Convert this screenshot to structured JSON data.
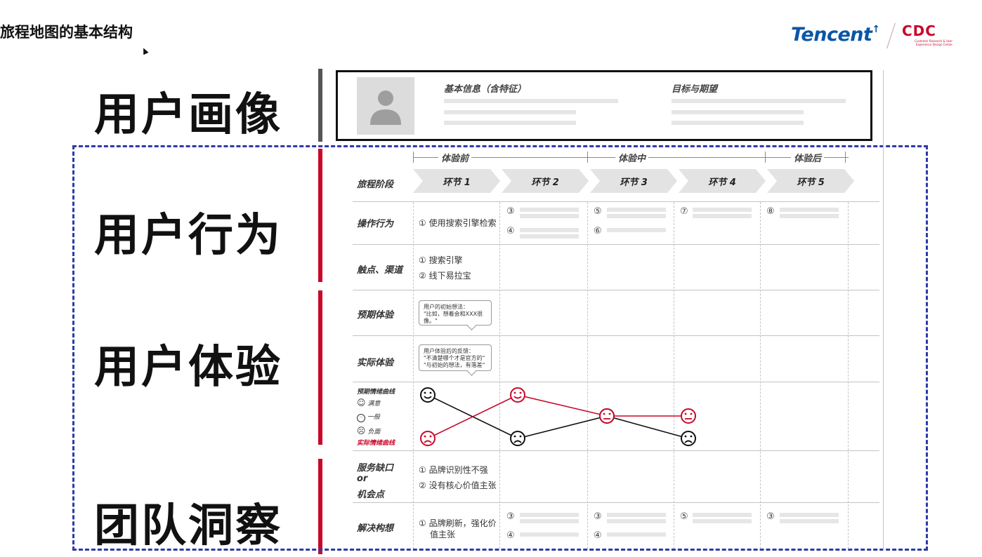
{
  "page_title": "旅程地图的基本结构",
  "logo": {
    "brand": "Tencent",
    "brand_mark": "↑",
    "cdc": "CDC",
    "cdc_sub": "Customer Research & User Experience Design Center"
  },
  "left_labels": [
    "用户画像",
    "用户行为",
    "用户体验",
    "团队洞察"
  ],
  "persona": {
    "basic_info": "基本信息（含特征）",
    "goals": "目标与期望"
  },
  "phases": [
    "体验前",
    "体验中",
    "体验后"
  ],
  "row_labels": {
    "stage": "旅程阶段",
    "operation": "操作行为",
    "touchpoint": "触点、渠道",
    "expected": "预期体验",
    "actual": "实际体验",
    "gap_a": "服务缺口",
    "gap_or": "or",
    "gap_b": "机会点",
    "solution": "解决构想"
  },
  "stages": [
    "环节 1",
    "环节 2",
    "环节 3",
    "环节 4",
    "环节 5"
  ],
  "operation": {
    "c1": "① 使用搜索引擎检索",
    "n3": "③",
    "n4": "④",
    "n5": "⑤",
    "n6": "⑥",
    "n7": "⑦",
    "n8": "⑧"
  },
  "touchpoint": {
    "t1": "① 搜索引擎",
    "t2": "② 线下易拉宝"
  },
  "expected_bubble": {
    "l1": "用户的初始想法：",
    "l2": "\"比如，想着会和XXX很像。\""
  },
  "actual_bubble": {
    "l1": "用户体验后的反馈：",
    "l2": "\"不清楚哪个才是官方的\"",
    "l3": "\"与初始的想法，有落差\""
  },
  "emotion_legend": {
    "title": "预期情绪曲线",
    "good": "满意",
    "neutral": "一般",
    "bad": "负面",
    "actual_title": "实际情绪曲线"
  },
  "emotion_glyphs": {
    "smile": "☺",
    "neutral": "😐",
    "sad": "☹"
  },
  "chart_data": {
    "type": "line",
    "categories": [
      "环节 1",
      "环节 2",
      "环节 3",
      "环节 4"
    ],
    "levels": [
      "负面",
      "一般",
      "满意"
    ],
    "series": [
      {
        "name": "预期情绪曲线",
        "values": [
          "满意",
          "负面",
          "一般",
          "负面"
        ],
        "color": "#111111"
      },
      {
        "name": "实际情绪曲线",
        "values": [
          "负面",
          "满意",
          "一般",
          "一般"
        ],
        "color": "#c9082a"
      }
    ]
  },
  "gap": {
    "g1": "① 品牌识别性不强",
    "g2": "② 没有核心价值主张"
  },
  "solution": {
    "s1a": "① 品牌刷新，强化价",
    "s1b": "值主张",
    "n3": "③",
    "n4": "④",
    "n3b": "③",
    "n4b": "④",
    "n5": "⑤",
    "n3c": "③"
  },
  "colors": {
    "accent_red": "#c9082a",
    "dash_blue": "#2f3aa8",
    "brand_blue": "#0a56a8"
  }
}
